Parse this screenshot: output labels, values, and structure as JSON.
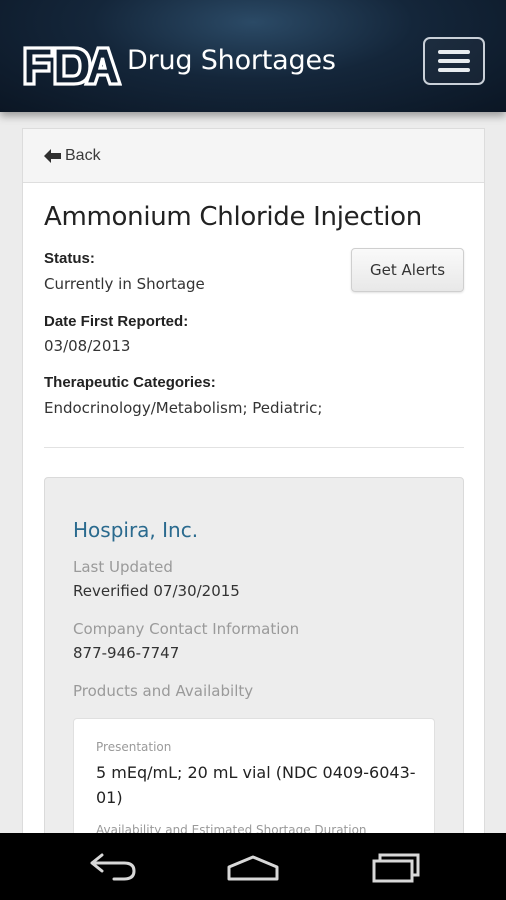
{
  "header": {
    "logo_text": "FDA",
    "title": "Drug Shortages",
    "menu_icon": "hamburger-menu-icon"
  },
  "back": {
    "label": "Back",
    "icon": "arrow-left-icon"
  },
  "drug": {
    "name": "Ammonium Chloride Injection",
    "status_label": "Status:",
    "status_value": "Currently in Shortage",
    "date_label": "Date First Reported:",
    "date_value": "03/08/2013",
    "categories_label": "Therapeutic Categories:",
    "categories_value": "Endocrinology/Metabolism; Pediatric;",
    "alerts_button": "Get Alerts"
  },
  "company": {
    "name": "Hospira, Inc.",
    "updated_label": "Last Updated",
    "updated_value": "Reverified 07/30/2015",
    "contact_label": "Company Contact Information",
    "contact_value": "877-946-7747",
    "products_label": "Products and Availabilty",
    "product": {
      "presentation_label": "Presentation",
      "presentation_value": "5 mEq/mL; 20 mL vial (NDC 0409-6043-01)",
      "availability_label": "Availability and Estimated Shortage Duration"
    }
  },
  "navbar": {
    "back_icon": "android-back-icon",
    "home_icon": "android-home-icon",
    "recents_icon": "android-recents-icon"
  },
  "colors": {
    "header_bg": "#14263a",
    "company_link": "#2a6a8e",
    "muted_text": "#9a9a9a"
  }
}
